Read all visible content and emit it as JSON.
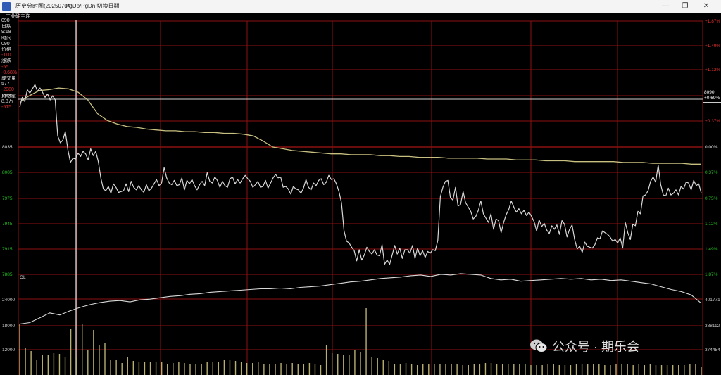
{
  "window": {
    "title": "历史分时图(20250704)",
    "hint": "PgUp/PgDn 切换日期",
    "minimize_icon": "minimize-icon",
    "maximize_icon": "restore-icon",
    "close_icon": "close-icon"
  },
  "subtitle": "工业硅主连",
  "info_panel": [
    "090",
    "日期",
    "9:18",
    "时间",
    "090",
    "价格",
    "-110",
    "涨跌",
    "-55",
    "-0.68%",
    "成交量",
    "577",
    "-2080",
    "持仓量",
    "8.8万",
    "-515"
  ],
  "watermark": {
    "text": "公众号 · 期乐会",
    "icon": "wechat-icon"
  },
  "current_price_box": {
    "price": "8090",
    "pct": "+0.69%"
  },
  "colors": {
    "background": "#000000",
    "grid": "#8b1010",
    "price_line": "#d8d8d8",
    "avg_line": "#c8c080",
    "up_text": "#e03030",
    "down_text": "#20c020",
    "volume_bar": "#b8b070",
    "oi_line": "#d8d8d8"
  },
  "chart_data": [
    {
      "type": "line",
      "name": "price-panel",
      "left_axis_labels": [
        "8090",
        "8035",
        "8005",
        "7975",
        "7945",
        "7915",
        "7885"
      ],
      "right_axis_labels": [
        "+1.87%",
        "+1.49%",
        "+1.12%",
        "+0.69%",
        "+0.37%",
        "0.00%",
        "0.37%",
        "0.75%",
        "1.12%",
        "1.49%",
        "1.87%"
      ],
      "reference_price": "8035",
      "series": [
        {
          "role": "price",
          "values": [
            8082,
            8093,
            8088,
            8102,
            8098,
            8103,
            8108,
            8100,
            8104,
            8099,
            8093,
            8097,
            8090,
            8095,
            8090,
            8048,
            8040,
            8043,
            8053,
            8032,
            8017,
            8022,
            8021,
            8028,
            8024,
            8030,
            8027,
            8020,
            8033,
            8025,
            8030,
            8018,
            7999,
            7986,
            7984,
            7989,
            7981,
            7992,
            7988,
            7982,
            7983,
            7984,
            7992,
            7983,
            7995,
            7988,
            7985,
            7990,
            7985,
            7982,
            7991,
            7984,
            7987,
            7992,
            7997,
            7990,
            7993,
            8011,
            7999,
            7993,
            7991,
            7996,
            7990,
            7991,
            7999,
            7985,
            7996,
            7992,
            7997,
            7990,
            7985,
            7991,
            7995,
            7990,
            8005,
            7995,
            7993,
            8000,
            7996,
            7988,
            7995,
            7990,
            7988,
            7998,
            8000,
            7992,
            7997,
            7993,
            7998,
            8002,
            7998,
            7995,
            7988,
            7991,
            7995,
            7988,
            7989,
            7996,
            7987,
            7993,
            7999,
            8003,
            7999,
            8000,
            7988,
            7989,
            7986,
            7980,
            7989,
            7986,
            7985,
            7981,
            7987,
            7997,
            7988,
            7985,
            7993,
            7990,
            7996,
            7998,
            7991,
            7994,
            8002,
            7997,
            7998,
            7992,
            7983,
            7970,
            7937,
            7925,
            7923,
            7918,
            7914,
            7902,
            7915,
            7903,
            7909,
            7918,
            7913,
            7910,
            7915,
            7909,
            7908,
            7921,
            7898,
            7903,
            7898,
            7909,
            7920,
            7910,
            7917,
            7905,
            7915,
            7915,
            7911,
            7920,
            7905,
            7917,
            7908,
            7914,
            7906,
            7913,
            7911,
            7915,
            7914,
            7926,
            7977,
            7988,
            7995,
            7996,
            7976,
            7973,
            7988,
            7966,
            7968,
            7983,
            7970,
            7965,
            7960,
            7951,
            7954,
            7961,
            7972,
            7957,
            7952,
            7947,
            7957,
            7939,
            7951,
            7949,
            7935,
            7947,
            7956,
            7962,
            7972,
            7965,
            7959,
            7963,
            7957,
            7961,
            7955,
            7959,
            7954,
            7948,
            7937,
            7950,
            7942,
            7946,
            7938,
            7934,
            7943,
            7939,
            7944,
            7933,
            7949,
            7945,
            7930,
            7939,
            7944,
            7927,
            7916,
            7919,
            7912,
            7924,
            7919,
            7918,
            7917,
            7921,
            7929,
            7928,
            7937,
            7935,
            7933,
            7930,
            7925,
            7927,
            7923,
            7929,
            7917,
            7947,
            7935,
            7927,
            7945,
            7943,
            7960,
            7957,
            7978,
            7979,
            7984,
            7995,
            8000,
            7994,
            8014,
            7991,
            7979,
            7978,
            7987,
            7979,
            7981,
            7985,
            7979,
            7989,
            7986,
            7994,
            7993,
            7985,
            7996,
            7990,
            7992,
            7981
          ]
        },
        {
          "role": "average",
          "values": [
            8088,
            8095,
            8101,
            8102,
            8104,
            8103,
            8099,
            8090,
            8074,
            8066,
            8062,
            8059,
            8058,
            8056,
            8055,
            8054,
            8054,
            8053,
            8053,
            8052,
            8052,
            8051,
            8051,
            8050,
            8048,
            8042,
            8035,
            8033,
            8031,
            8030,
            8029,
            8028,
            8027,
            8027,
            8026,
            8026,
            8026,
            8025,
            8025,
            8024,
            8024,
            8023,
            8023,
            8023,
            8022,
            8022,
            8022,
            8022,
            8021,
            8021,
            8021,
            8020,
            8020,
            8020,
            8019,
            8019,
            8019,
            8018,
            8018,
            8018,
            8018,
            8018,
            8017,
            8017,
            8017,
            8016,
            8016,
            8016,
            8016,
            8015,
            8015
          ]
        }
      ]
    },
    {
      "type": "bar",
      "name": "volume-oi-panel",
      "left_axis_labels": [
        "OL",
        "24000",
        "18000",
        "12000"
      ],
      "right_axis_labels": [
        "401771",
        "388112",
        "374454"
      ],
      "series": [
        {
          "role": "open_interest",
          "values": [
            24,
            26,
            33,
            40,
            37,
            43,
            48,
            52,
            55,
            57,
            58,
            56,
            59,
            60,
            62,
            64,
            65,
            67,
            68,
            70,
            71,
            72,
            73,
            74,
            75,
            75,
            76,
            75,
            77,
            78,
            79,
            81,
            83,
            85,
            86,
            88,
            90,
            91,
            92,
            94,
            95,
            93,
            96,
            95,
            97,
            96,
            95,
            90,
            88,
            89,
            86,
            87,
            88,
            89,
            90,
            89,
            90,
            88,
            89,
            87,
            88,
            86,
            84,
            82,
            78,
            74,
            71,
            66,
            54
          ]
        },
        {
          "role": "volume",
          "values": [
            72,
            38,
            34,
            22,
            28,
            28,
            31,
            30,
            25,
            66,
            25,
            72,
            35,
            64,
            42,
            45,
            22,
            22,
            17,
            26,
            20,
            19,
            18,
            18,
            18,
            18,
            16,
            17,
            18,
            17,
            16,
            16,
            16,
            19,
            18,
            18,
            22,
            21,
            20,
            18,
            17,
            17,
            18,
            16,
            16,
            16,
            17,
            16,
            17,
            16,
            16,
            17,
            15,
            14,
            42,
            31,
            30,
            29,
            28,
            35,
            33,
            95,
            25,
            24,
            22,
            20,
            16,
            16,
            17,
            15,
            14,
            16,
            15,
            15,
            15,
            15,
            15,
            15,
            14,
            14,
            16,
            16,
            17,
            17,
            16,
            15,
            15,
            15,
            16,
            15,
            14,
            14,
            14,
            16,
            16,
            14,
            14,
            14,
            15,
            16,
            16,
            16,
            15,
            14,
            14,
            16,
            15,
            15,
            14,
            15,
            14,
            15,
            14,
            14,
            14,
            14,
            14,
            14,
            15,
            15,
            12
          ]
        }
      ]
    }
  ]
}
